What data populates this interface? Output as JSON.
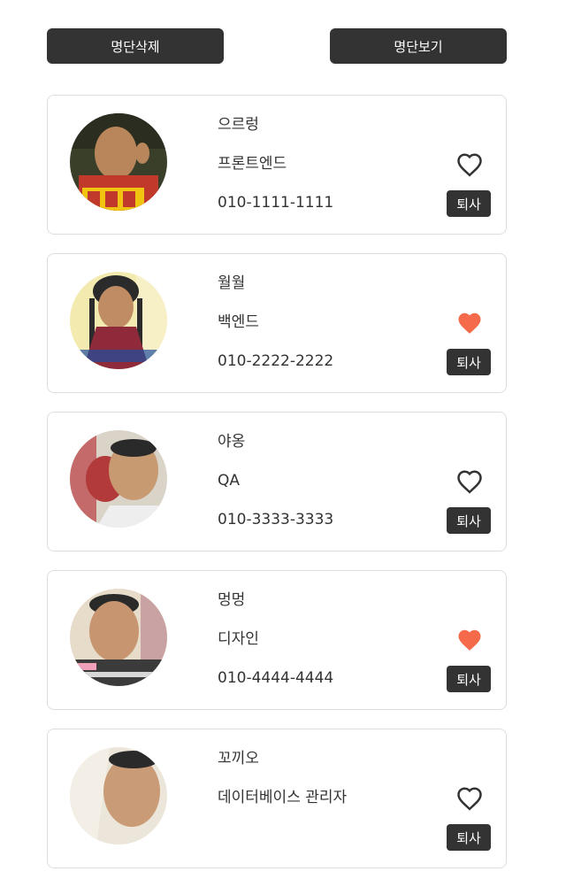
{
  "toolbar": {
    "delete_label": "명단삭제",
    "view_label": "명단보기"
  },
  "colors": {
    "button_bg": "#333333",
    "heart_filled": "#f46a4b",
    "heart_outline": "#333333",
    "card_border": "#dddddd"
  },
  "employees": [
    {
      "name": "으르렁",
      "role": "프론트엔드",
      "phone": "010-1111-1111",
      "liked": false,
      "fire_label": "퇴사"
    },
    {
      "name": "월월",
      "role": "백엔드",
      "phone": "010-2222-2222",
      "liked": true,
      "fire_label": "퇴사"
    },
    {
      "name": "야옹",
      "role": "QA",
      "phone": "010-3333-3333",
      "liked": false,
      "fire_label": "퇴사"
    },
    {
      "name": "멍멍",
      "role": "디자인",
      "phone": "010-4444-4444",
      "liked": true,
      "fire_label": "퇴사"
    },
    {
      "name": "꼬끼오",
      "role": "데이터베이스 관리자",
      "phone": "",
      "liked": false,
      "fire_label": "퇴사"
    }
  ]
}
